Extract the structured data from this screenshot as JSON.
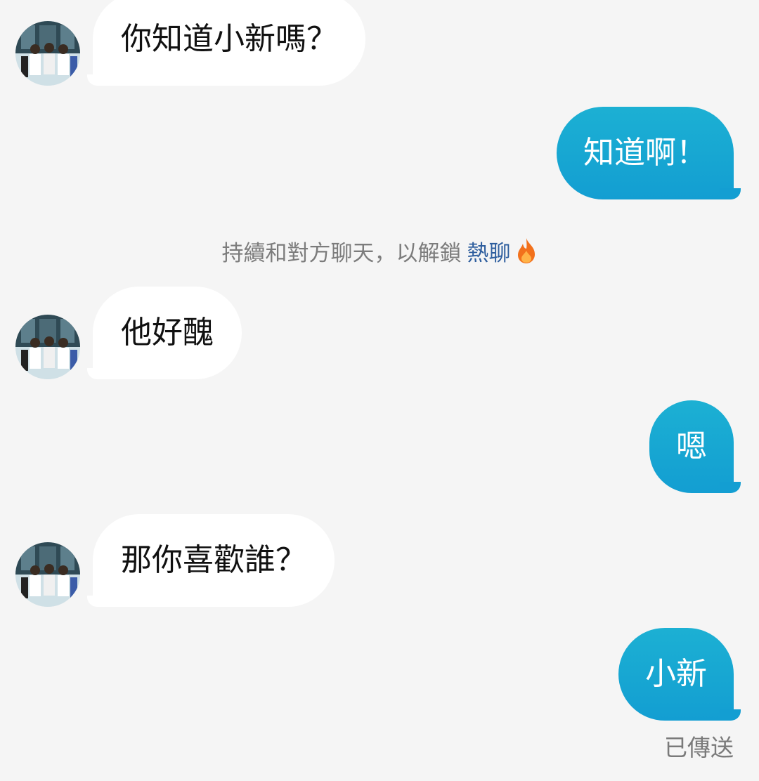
{
  "conversation": {
    "messages": [
      {
        "direction": "incoming",
        "text": "你知道小新嗎？"
      },
      {
        "direction": "outgoing",
        "text": "知道啊！"
      },
      {
        "direction": "incoming",
        "text": "他好醜"
      },
      {
        "direction": "outgoing",
        "text": "嗯"
      },
      {
        "direction": "incoming",
        "text": "那你喜歡誰？"
      },
      {
        "direction": "outgoing",
        "text": "小新"
      }
    ],
    "system_notice": {
      "prefix": "持續和對方聊天，以解鎖",
      "highlight": "熱聊",
      "icon": "fire-icon"
    },
    "delivery_status": "已傳送"
  },
  "colors": {
    "background": "#f5f5f5",
    "incoming_bubble": "#ffffff",
    "outgoing_bubble": "#139ed2",
    "highlight_text": "#2e5e9e",
    "fire": "#f2711c"
  }
}
